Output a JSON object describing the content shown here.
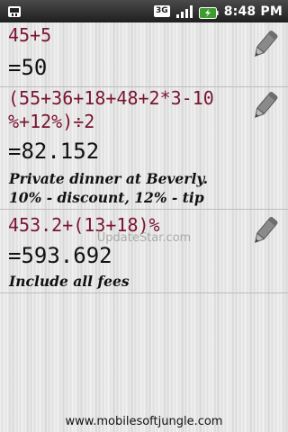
{
  "status_bar": {
    "network_type": "3G",
    "time": "8:48 PM",
    "icons": [
      "usb-icon",
      "signal-icon",
      "battery-icon"
    ]
  },
  "entries": [
    {
      "expression": "45+5",
      "result": "=50",
      "note": ""
    },
    {
      "expression_lines": [
        "(55+36+18+48+2*3-10",
        "%+12%)÷2"
      ],
      "result": "=82.152",
      "note_lines": [
        "Private dinner at Beverly.",
        "10% - discount, 12% - tip"
      ]
    },
    {
      "expression": "453.2+(13+18)%",
      "result": "=593.692",
      "note": "Include all fees"
    }
  ],
  "watermark": "UpdateStar.com",
  "footer": "www.mobilesoftjungle.com",
  "colors": {
    "expression": "#7a1430",
    "result": "#111111",
    "status_bar": "#2a2a2a"
  }
}
